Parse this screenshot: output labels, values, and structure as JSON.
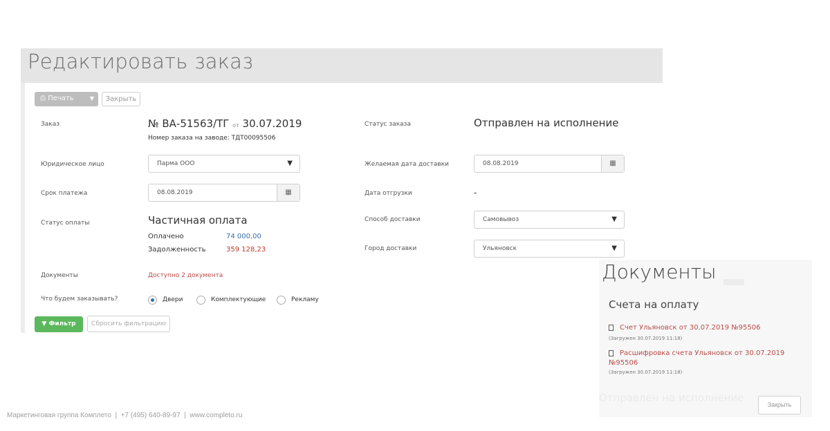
{
  "header": {
    "title": "Редактировать заказ"
  },
  "toolbar": {
    "print_label": "Печать",
    "close_label": "Закрыть"
  },
  "order": {
    "label": "Заказ",
    "number": "№ ВА-51563/ТГ",
    "of_word": "от",
    "date": "30.07.2019",
    "factory_number": "Номер заказа на заводе: ТДТ00095506"
  },
  "order_status": {
    "label": "Статус заказа",
    "value": "Отправлен на исполнение"
  },
  "legal_entity": {
    "label": "Юридическое лицо",
    "value": "Парма ООО"
  },
  "desired_delivery": {
    "label": "Желаемая дата доставки",
    "value": "08.08.2019"
  },
  "payment_term": {
    "label": "Срок платежа",
    "value": "08.08.2019"
  },
  "shipment_date": {
    "label": "Дата отгрузки",
    "value": "-"
  },
  "payment_status": {
    "label": "Статус оплаты",
    "value": "Частичная оплата",
    "paid_label": "Оплачено",
    "paid_value": "74 000,00",
    "debt_label": "Задолженность",
    "debt_value": "359 128,23"
  },
  "delivery_method": {
    "label": "Способ доставки",
    "value": "Самовывоз"
  },
  "delivery_city": {
    "label": "Город доставки",
    "value": "Ульяновск"
  },
  "documents": {
    "label": "Документы",
    "link": "Доступно 2 документа"
  },
  "order_type": {
    "label": "Что будем заказывать?",
    "options": [
      "Двери",
      "Комплектующие",
      "Рекламу"
    ],
    "selected": "Двери"
  },
  "filter": {
    "filter_label": "Фильтр",
    "reset_label": "Сбросить фильтрацию"
  },
  "footer": {
    "text": "Маркетинговая группа Комплето  |  +7 (495) 640-89-97  |  www.completo.ru"
  },
  "docs_modal": {
    "title": "Документы",
    "subtitle": "Счета на оплату",
    "items": [
      {
        "link": "Счет Ульяновск от 30.07.2019 №95506",
        "meta": "(Загружен 30.07.2019 11:18)"
      },
      {
        "link_line1": "Расшифровка счета Ульяновск от 30.07.2019",
        "link_line2": "№95506",
        "meta": "(Загружен 30.07.2019 11:18)"
      }
    ],
    "ghost_status": "Отправлен на исполнение",
    "close_label": "Закрыть"
  },
  "icons": {
    "print": "printer-icon",
    "caret": "caret-down-icon",
    "calendar": "calendar-icon",
    "select_arrow": "triangle-down-icon",
    "filter": "funnel-icon",
    "document": "file-icon"
  },
  "colors": {
    "accent_green": "#5cb85c",
    "link_red": "#b94a48",
    "value_blue": "#3a6ea5",
    "debt_red": "#c0392b"
  }
}
